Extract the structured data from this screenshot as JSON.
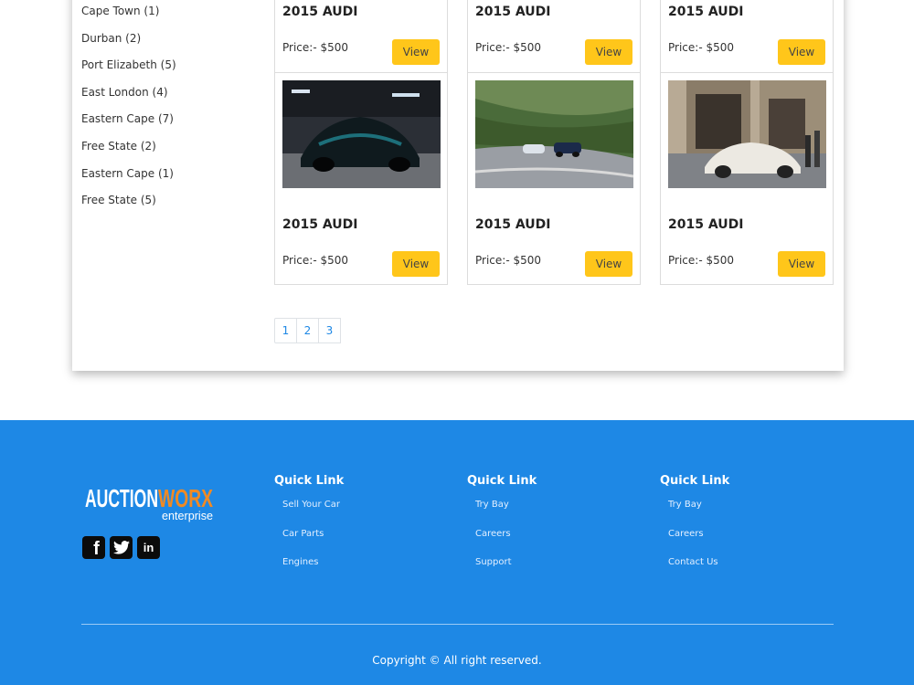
{
  "locations": [
    "Cape Town (1)",
    "Durban (2)",
    "Port Elizabeth (5)",
    "East London (4)",
    "Eastern Cape (7)",
    "Free State (2)",
    "Eastern Cape (1)",
    "Free State (5)"
  ],
  "cards_top": [
    {
      "title": "2015 AUDI",
      "price": "Price:- $500",
      "button": "View"
    },
    {
      "title": "2015 AUDI",
      "price": "Price:- $500",
      "button": "View"
    },
    {
      "title": "2015 AUDI",
      "price": "Price:- $500",
      "button": "View"
    }
  ],
  "cards": [
    {
      "title": "2015 AUDI",
      "price": "Price:- $500",
      "button": "View"
    },
    {
      "title": "2015 AUDI",
      "price": "Price:- $500",
      "button": "View"
    },
    {
      "title": "2015 AUDI",
      "price": "Price:- $500",
      "button": "View"
    }
  ],
  "pagination": [
    "1",
    "2",
    "3"
  ],
  "footer": {
    "logo_main_a": "AUCTION",
    "logo_main_b": "WORX",
    "logo_sub": "enterprise",
    "columns": [
      {
        "heading": "Quick Link",
        "links": [
          "Sell Your Car",
          "Car Parts",
          "Engines"
        ]
      },
      {
        "heading": "Quick Link",
        "links": [
          "Try Bay",
          "Careers",
          "Support"
        ]
      },
      {
        "heading": "Quick Link",
        "links": [
          "Try Bay",
          "Careers",
          "Contact Us"
        ]
      }
    ],
    "copyright": "Copyright © All right reserved."
  },
  "colors": {
    "accent_button": "#ffc61a",
    "footer_bg": "#1e88e5",
    "logo_orange": "#f08a24"
  },
  "icons": [
    "facebook-icon",
    "twitter-icon",
    "linkedin-icon"
  ]
}
